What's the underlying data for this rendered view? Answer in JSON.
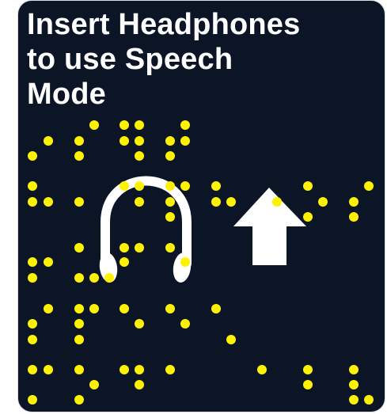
{
  "sign": {
    "title_lines": [
      "Insert Headphones",
      "to use Speech",
      "Mode"
    ]
  },
  "icons": {
    "headphones": "headphones-icon",
    "arrow": "arrow-up-icon"
  },
  "colors": {
    "background": "#0b1526",
    "border": "#d9dee6",
    "text": "#ffffff",
    "braille_dot": "#fff200",
    "icon": "#ffffff"
  }
}
